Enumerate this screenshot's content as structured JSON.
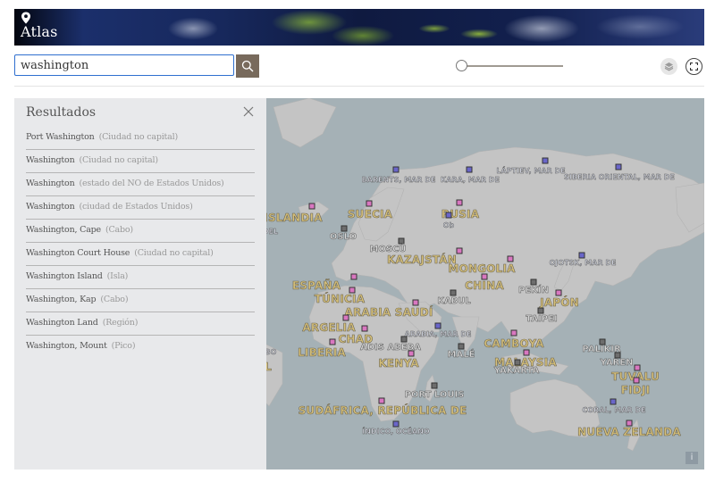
{
  "app": {
    "title": "Atlas",
    "logo_icon": "map-pin-icon"
  },
  "search": {
    "value": "washington",
    "button_icon": "search-icon"
  },
  "zoom_slider": {
    "value": 0
  },
  "toolbar": {
    "layers_icon": "layers-icon",
    "fullscreen_icon": "fullscreen-icon"
  },
  "results": {
    "title": "Resultados",
    "close_icon": "close-icon",
    "items": [
      {
        "name": "Port Washington",
        "type": "(Ciudad no capital)"
      },
      {
        "name": "Washington",
        "type": "(Ciudad no capital)"
      },
      {
        "name": "Washington",
        "type": "(estado del NO de Estados Unidos)"
      },
      {
        "name": "Washington",
        "type": "(ciudad de Estados Unidos)"
      },
      {
        "name": "Washington, Cape",
        "type": "(Cabo)"
      },
      {
        "name": "Washington Court House",
        "type": "(Ciudad no capital)"
      },
      {
        "name": "Washington Island",
        "type": "(Isla)"
      },
      {
        "name": "Washington, Kap",
        "type": "(Cabo)"
      },
      {
        "name": "Washington Land",
        "type": "(Región)"
      },
      {
        "name": "Washington, Mount",
        "type": "(Pico)"
      }
    ]
  },
  "map": {
    "info_label": "i",
    "colors": {
      "country_marker": "#d977c0",
      "city_marker": "#6d6d6d",
      "sea_marker": "#6a66c9",
      "country_text": "#d6c07a"
    },
    "labels": [
      {
        "text": "BARENTS, MAR DE",
        "kind": "sea"
      },
      {
        "text": "KARA, MAR DE",
        "kind": "sea"
      },
      {
        "text": "LÁPTIEV, MAR DE",
        "kind": "sea"
      },
      {
        "text": "SIBERIA ORIENTAL, MAR DE",
        "kind": "sea"
      },
      {
        "text": "ISLANDIA",
        "kind": "country"
      },
      {
        "text": "SUECIA",
        "kind": "country"
      },
      {
        "text": "RUSIA",
        "kind": "country"
      },
      {
        "text": "Ob",
        "kind": "sea"
      },
      {
        "text": "R DEL",
        "kind": "sea"
      },
      {
        "text": "OSLO",
        "kind": "city"
      },
      {
        "text": "MOSCÚ",
        "kind": "city"
      },
      {
        "text": "KAZAJSTÁN",
        "kind": "country"
      },
      {
        "text": "MONGOLIA",
        "kind": "country"
      },
      {
        "text": "OJOTSK, MAR DE",
        "kind": "sea"
      },
      {
        "text": "ESPAÑA",
        "kind": "country"
      },
      {
        "text": "CHINA",
        "kind": "country"
      },
      {
        "text": "PEKÍN",
        "kind": "city"
      },
      {
        "text": "TÚNICIA",
        "kind": "country"
      },
      {
        "text": "KABUL",
        "kind": "city"
      },
      {
        "text": "JAPÓN",
        "kind": "country"
      },
      {
        "text": "ARABIA SAUDÍ",
        "kind": "country"
      },
      {
        "text": "TAIPEI",
        "kind": "city"
      },
      {
        "text": "ARGELIA",
        "kind": "country"
      },
      {
        "text": "CHAD",
        "kind": "country"
      },
      {
        "text": "ARABIA, MAR DE",
        "kind": "sea"
      },
      {
        "text": "CAMBOYA",
        "kind": "country"
      },
      {
        "text": "ADIS ABEBA",
        "kind": "city"
      },
      {
        "text": "LIBERIA",
        "kind": "country"
      },
      {
        "text": "MALÉ",
        "kind": "city"
      },
      {
        "text": "MALAYSIA",
        "kind": "country"
      },
      {
        "text": "PALIKIR",
        "kind": "city"
      },
      {
        "text": "KENYA",
        "kind": "country"
      },
      {
        "text": "YAKARTA",
        "kind": "city"
      },
      {
        "text": "YAREN",
        "kind": "city"
      },
      {
        "text": "TUVALU",
        "kind": "country"
      },
      {
        "text": "FIDJI",
        "kind": "country"
      },
      {
        "text": "PORT LOUIS",
        "kind": "city"
      },
      {
        "text": "SUDÁFRICA, REPÚBLICA DE",
        "kind": "country"
      },
      {
        "text": "CORAL, MAR DE",
        "kind": "sea"
      },
      {
        "text": "ÍNDICO, OCÉANO",
        "kind": "sea"
      },
      {
        "text": "NUEVA ZELANDA",
        "kind": "country"
      },
      {
        "text": "BO",
        "kind": "sea"
      },
      {
        "text": "L",
        "kind": "country"
      }
    ]
  }
}
